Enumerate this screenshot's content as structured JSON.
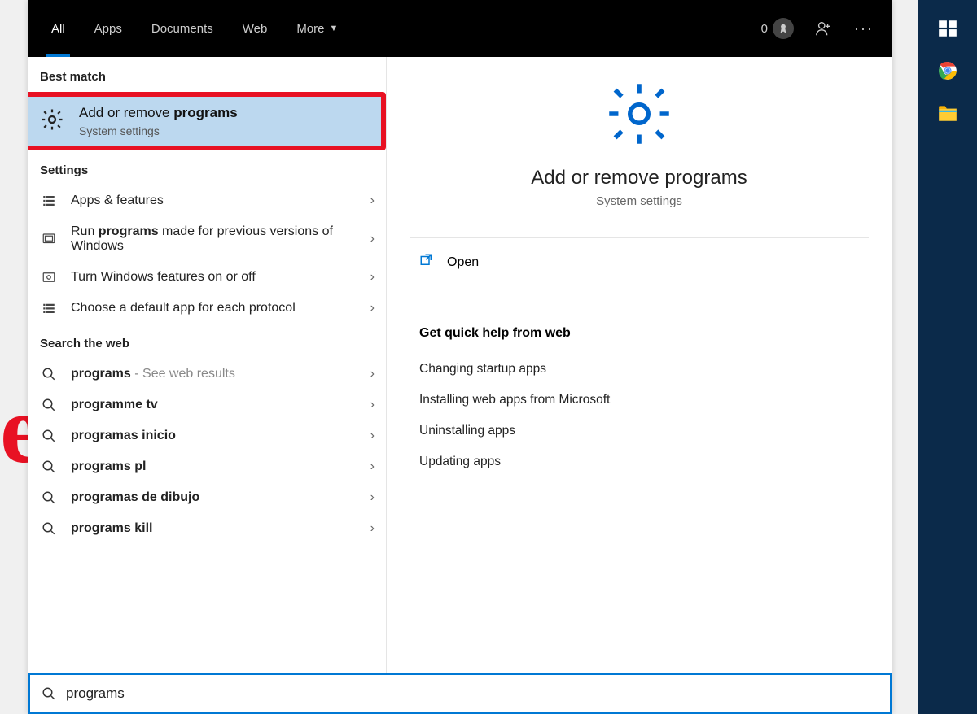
{
  "topbar": {
    "tabs": [
      "All",
      "Apps",
      "Documents",
      "Web",
      "More"
    ],
    "points": "0"
  },
  "sections": {
    "best_match": "Best match",
    "settings": "Settings",
    "search_web": "Search the web"
  },
  "best": {
    "title_pre": "Add or remove ",
    "title_bold": "programs",
    "subtitle": "System settings"
  },
  "settings_items": [
    {
      "pre": "Apps & features",
      "bold": "",
      "post": ""
    },
    {
      "pre": "Run ",
      "bold": "programs",
      "post": " made for previous versions of Windows"
    },
    {
      "pre": "Turn Windows features on or off",
      "bold": "",
      "post": ""
    },
    {
      "pre": "Choose a default app for each protocol",
      "bold": "",
      "post": ""
    }
  ],
  "web_items": [
    {
      "bold": "programs",
      "post": "",
      "hint": " - See web results"
    },
    {
      "bold": "programme tv",
      "post": "",
      "hint": ""
    },
    {
      "bold": "programas inicio",
      "post": "",
      "hint": ""
    },
    {
      "bold": "programs pl",
      "post": "",
      "hint": ""
    },
    {
      "bold": "programas de dibujo",
      "post": "",
      "hint": ""
    },
    {
      "bold": "programs kill",
      "post": "",
      "hint": ""
    }
  ],
  "detail": {
    "title": "Add or remove programs",
    "subtitle": "System settings",
    "open": "Open",
    "help_title": "Get quick help from web",
    "help_links": [
      "Changing startup apps",
      "Installing web apps from Microsoft",
      "Uninstalling apps",
      "Updating apps"
    ]
  },
  "search": {
    "value": "programs"
  }
}
